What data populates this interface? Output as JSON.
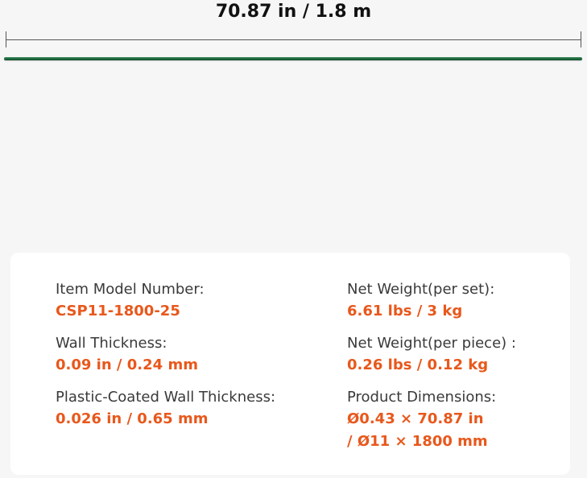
{
  "dimension": {
    "label": "70.87 in / 1.8 m"
  },
  "specs": {
    "left": [
      {
        "label": "Item Model Number:",
        "value": "CSP11-1800-25"
      },
      {
        "label": "Wall Thickness:",
        "value": "0.09 in / 0.24 mm"
      },
      {
        "label": "Plastic-Coated Wall Thickness:",
        "value": "0.026 in / 0.65 mm"
      }
    ],
    "right": [
      {
        "label": "Net Weight(per set):",
        "value": "6.61 lbs / 3 kg"
      },
      {
        "label": "Net Weight(per piece) :",
        "value": "0.26 lbs / 0.12 kg"
      },
      {
        "label": "Product Dimensions:",
        "value": "Ø0.43 × 70.87 in",
        "value2": "/ Ø11 × 1800 mm"
      }
    ]
  },
  "colors": {
    "accent": "#e8581c",
    "stake": "#1f6b40",
    "background": "#f6f6f6",
    "panel": "#ffffff"
  }
}
